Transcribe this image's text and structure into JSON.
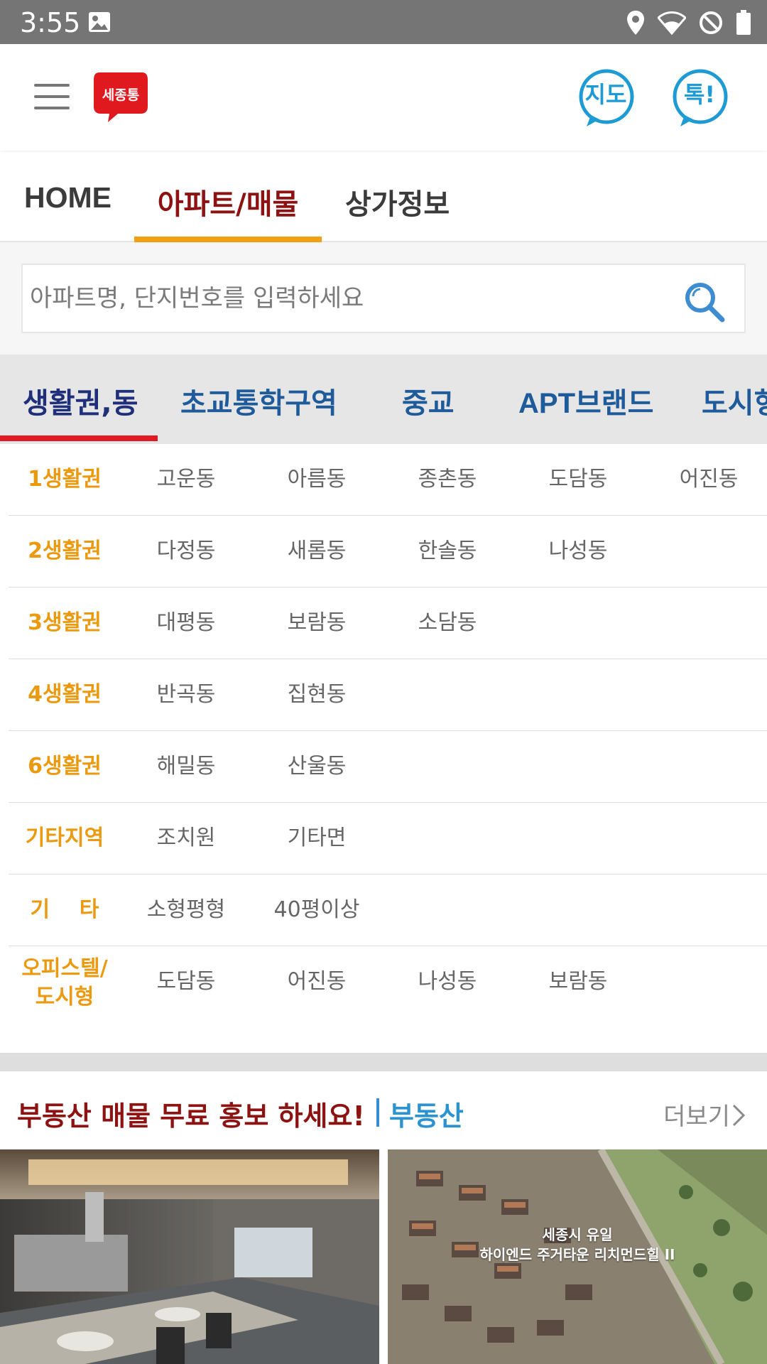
{
  "status_bar": {
    "time": "3:55",
    "icons": [
      "image-icon",
      "location-icon",
      "wifi-icon",
      "do-not-disturb-icon",
      "battery-icon"
    ]
  },
  "header": {
    "logo_text": "세종통",
    "map_button": "지도",
    "talk_button": "톡!"
  },
  "main_tabs": [
    {
      "label": "HOME",
      "active": false
    },
    {
      "label": "아파트/매물",
      "active": true
    },
    {
      "label": "상가정보",
      "active": false
    }
  ],
  "search": {
    "placeholder": "아파트명, 단지번호를 입력하세요"
  },
  "category_tabs": [
    {
      "label": "생활권,동",
      "active": true
    },
    {
      "label": "초교통학구역",
      "active": false
    },
    {
      "label": "중교",
      "active": false
    },
    {
      "label": "APT브랜드",
      "active": false
    },
    {
      "label": "도시형",
      "active": false
    }
  ],
  "regions": [
    {
      "label": "1생활권",
      "dongs": [
        "고운동",
        "아름동",
        "종촌동",
        "도담동",
        "어진동"
      ]
    },
    {
      "label": "2생활권",
      "dongs": [
        "다정동",
        "새롬동",
        "한솔동",
        "나성동"
      ]
    },
    {
      "label": "3생활권",
      "dongs": [
        "대평동",
        "보람동",
        "소담동"
      ]
    },
    {
      "label": "4생활권",
      "dongs": [
        "반곡동",
        "집현동"
      ]
    },
    {
      "label": "6생활권",
      "dongs": [
        "해밀동",
        "산울동"
      ]
    },
    {
      "label": "기타지역",
      "dongs": [
        "조치원",
        "기타면"
      ]
    },
    {
      "label": "기    타",
      "dongs": [
        "소형평형",
        "40평이상"
      ]
    },
    {
      "label": "오피스텔/\n도시형",
      "dongs": [
        "도담동",
        "어진동",
        "나성동",
        "보람동"
      ]
    }
  ],
  "promo": {
    "title": "부동산 매물 무료 홍보 하세요!",
    "subtitle": "부동산",
    "more": "더보기",
    "thumb2_caption_line1": "세종시 유일",
    "thumb2_caption_line2": "하이엔드 주거타운 리치먼드힐 II"
  },
  "colors": {
    "accent_red": "#8d1313",
    "accent_orange": "#f0a012",
    "accent_blue": "#1e9bd4",
    "status_bar": "#757575"
  }
}
